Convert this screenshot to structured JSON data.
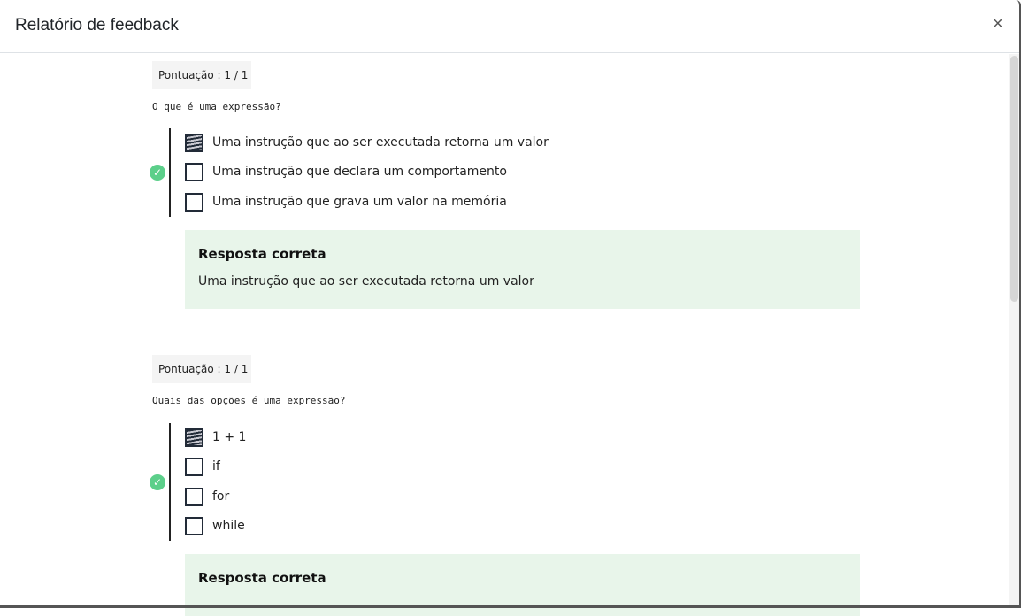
{
  "modal": {
    "title": "Relatório de feedback",
    "close_icon": "×"
  },
  "questions": [
    {
      "score": "Pontuação : 1 / 1",
      "text": "O que é uma expressão?",
      "status_icon": "check-circle",
      "options": [
        {
          "label": "Uma instrução que ao ser executada retorna um valor",
          "checked": true
        },
        {
          "label": "Uma instrução que declara um comportamento",
          "checked": false
        },
        {
          "label": "Uma instrução que grava um valor na memória",
          "checked": false
        }
      ],
      "answer_title": "Resposta correta",
      "answer_text": "Uma instrução que ao ser executada retorna um valor"
    },
    {
      "score": "Pontuação : 1 / 1",
      "text": "Quais das opções é uma expressão?",
      "status_icon": "check-circle",
      "options": [
        {
          "label": "1 + 1",
          "checked": true
        },
        {
          "label": "if",
          "checked": false
        },
        {
          "label": "for",
          "checked": false
        },
        {
          "label": "while",
          "checked": false
        }
      ],
      "answer_title": "Resposta correta"
    }
  ],
  "colors": {
    "success": "#5ccf8a",
    "answer_bg": "#e8f5ea"
  }
}
